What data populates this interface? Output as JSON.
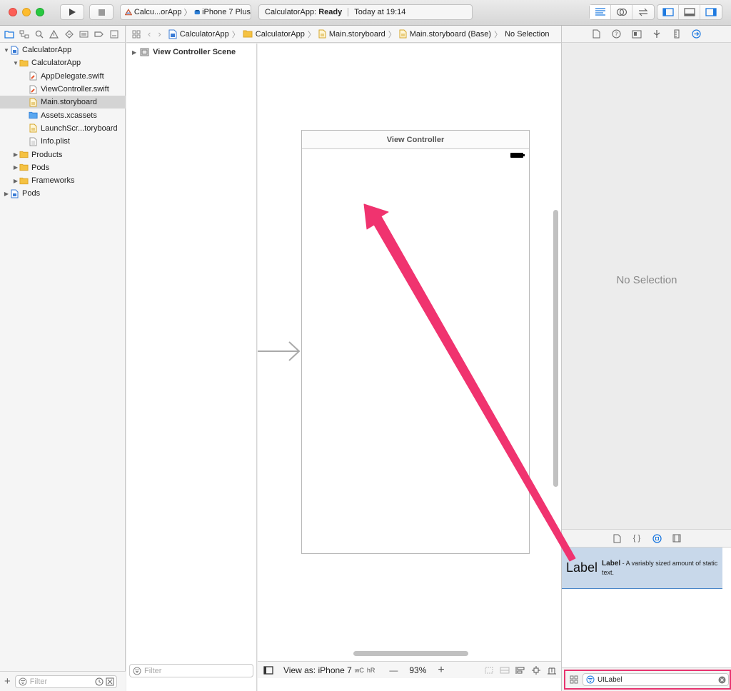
{
  "toolbar": {
    "scheme_name": "Calcu...orApp",
    "device": "iPhone 7 Plus",
    "status_app": "CalculatorApp:",
    "status_state": "Ready",
    "status_time": "Today at 19:14"
  },
  "navigator": {
    "items": [
      {
        "label": "CalculatorApp",
        "depth": 0,
        "disclosure": "open",
        "icon": "project-icon"
      },
      {
        "label": "CalculatorApp",
        "depth": 1,
        "disclosure": "open",
        "icon": "folder-icon"
      },
      {
        "label": "AppDelegate.swift",
        "depth": 2,
        "disclosure": "none",
        "icon": "swift-file-icon"
      },
      {
        "label": "ViewController.swift",
        "depth": 2,
        "disclosure": "none",
        "icon": "swift-file-icon"
      },
      {
        "label": "Main.storyboard",
        "depth": 2,
        "disclosure": "none",
        "icon": "storyboard-file-icon",
        "selected": true
      },
      {
        "label": "Assets.xcassets",
        "depth": 2,
        "disclosure": "none",
        "icon": "assets-folder-icon"
      },
      {
        "label": "LaunchScr...toryboard",
        "depth": 2,
        "disclosure": "none",
        "icon": "storyboard-file-icon"
      },
      {
        "label": "Info.plist",
        "depth": 2,
        "disclosure": "none",
        "icon": "plist-file-icon"
      },
      {
        "label": "Products",
        "depth": 1,
        "disclosure": "closed",
        "icon": "folder-icon"
      },
      {
        "label": "Pods",
        "depth": 1,
        "disclosure": "closed",
        "icon": "folder-icon"
      },
      {
        "label": "Frameworks",
        "depth": 1,
        "disclosure": "closed",
        "icon": "folder-icon"
      },
      {
        "label": "Pods",
        "depth": 0,
        "disclosure": "closed",
        "icon": "project-icon"
      }
    ],
    "filter_placeholder": "Filter"
  },
  "jumpbar": {
    "crumbs": [
      "CalculatorApp",
      "CalculatorApp",
      "Main.storyboard",
      "Main.storyboard (Base)",
      "No Selection"
    ]
  },
  "outline": {
    "scene": "View Controller Scene",
    "filter_placeholder": "Filter"
  },
  "canvas": {
    "scene_title": "View Controller"
  },
  "canvasbar": {
    "view_as": "View as: iPhone 7",
    "size_w": "wC",
    "size_h": "hR",
    "zoom_out": "—",
    "zoom": "93%",
    "zoom_in": "+"
  },
  "inspector": {
    "no_selection": "No Selection"
  },
  "library": {
    "item_big": "Label",
    "item_name": "Label",
    "item_desc": " - A variably sized amount of static text.",
    "search_value": "UILabel"
  },
  "colors": {
    "accent": "#1f7ae0",
    "annotation": "#f0336f",
    "folder": "#f5c242"
  }
}
